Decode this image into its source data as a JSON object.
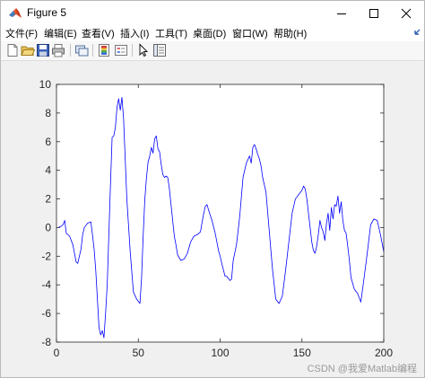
{
  "window": {
    "title": "Figure 5"
  },
  "menu": {
    "items": [
      "文件(F)",
      "编辑(E)",
      "查看(V)",
      "插入(I)",
      "工具(T)",
      "桌面(D)",
      "窗口(W)",
      "帮助(H)"
    ]
  },
  "toolbar": {
    "buttons": [
      "new-figure-icon",
      "open-file-icon",
      "save-icon",
      "print-icon",
      "link-plot-icon",
      "insert-colorbar-icon",
      "insert-legend-icon",
      "edit-plot-arrow-icon",
      "property-inspector-icon"
    ]
  },
  "watermark": "CSDN @我爱Matlab编程",
  "chart_data": {
    "type": "line",
    "title": "",
    "xlabel": "",
    "ylabel": "",
    "xlim": [
      0,
      200
    ],
    "ylim": [
      -8,
      10
    ],
    "xticks": [
      0,
      50,
      100,
      150,
      200
    ],
    "yticks": [
      -8,
      -6,
      -4,
      -2,
      0,
      2,
      4,
      6,
      8,
      10
    ],
    "grid": false,
    "series": [
      {
        "color": "#0000ff",
        "x": [
          1,
          3,
          4,
          5,
          6,
          8,
          10,
          12,
          13,
          14,
          15,
          16,
          17,
          19,
          21,
          22,
          23,
          24,
          25,
          26,
          27,
          28,
          29,
          30,
          31,
          32,
          33,
          34,
          35,
          36,
          37,
          38,
          39,
          40,
          41,
          43,
          45,
          47,
          49,
          51,
          52,
          53,
          54,
          55,
          56,
          57,
          58,
          59,
          60,
          61,
          62,
          63,
          64,
          65,
          66,
          67,
          68,
          69,
          70,
          71,
          72,
          73,
          74,
          76,
          78,
          80,
          82,
          84,
          86,
          88,
          89,
          90,
          91,
          92,
          93,
          95,
          97,
          99,
          100,
          101,
          103,
          104,
          106,
          107,
          108,
          110,
          112,
          114,
          116,
          118,
          119,
          120,
          121,
          122,
          123,
          124,
          125,
          126,
          127,
          128,
          130,
          132,
          134,
          136,
          138,
          140,
          142,
          144,
          146,
          148,
          150,
          151,
          152,
          153,
          154,
          155,
          156,
          157,
          158,
          159,
          160,
          161,
          162,
          163,
          164,
          165,
          166,
          167,
          168,
          169,
          170,
          171,
          172,
          173,
          174,
          175,
          176,
          177,
          178,
          179,
          180,
          182,
          184,
          186,
          188,
          190,
          192,
          194,
          196,
          198,
          200
        ],
        "y": [
          0.0,
          0.1,
          0.2,
          0.5,
          -0.4,
          -0.6,
          -1.2,
          -2.4,
          -2.5,
          -2.0,
          -1.5,
          -0.5,
          0.0,
          0.3,
          0.4,
          -0.5,
          -1.5,
          -3.0,
          -5.0,
          -7.0,
          -7.5,
          -7.2,
          -7.7,
          -6.0,
          -4.0,
          -0.5,
          3.0,
          6.3,
          6.4,
          7.0,
          8.4,
          9.0,
          8.2,
          9.1,
          7.6,
          2.0,
          -1.6,
          -4.5,
          -5.0,
          -5.3,
          -3.5,
          -0.5,
          2.0,
          3.5,
          4.6,
          5.0,
          5.6,
          5.2,
          6.2,
          6.4,
          5.5,
          5.3,
          4.4,
          3.7,
          3.5,
          3.6,
          3.5,
          2.7,
          1.6,
          0.5,
          -0.6,
          -1.2,
          -1.9,
          -2.3,
          -2.2,
          -1.8,
          -1.0,
          -0.6,
          -0.5,
          -0.3,
          0.4,
          1.0,
          1.5,
          1.6,
          1.2,
          0.5,
          -0.4,
          -1.6,
          -2.0,
          -2.5,
          -3.4,
          -3.4,
          -3.7,
          -3.6,
          -2.3,
          -1.2,
          0.8,
          3.5,
          4.5,
          5.0,
          4.5,
          5.6,
          5.8,
          5.5,
          5.1,
          4.8,
          4.3,
          3.5,
          3.0,
          2.5,
          -0.2,
          -2.9,
          -5.0,
          -5.3,
          -4.8,
          -3.0,
          -1.0,
          1.0,
          2.0,
          2.3,
          2.6,
          2.9,
          2.7,
          2.0,
          1.0,
          0.0,
          -1.0,
          -1.6,
          -1.8,
          -1.3,
          -0.5,
          0.5,
          0.0,
          -0.3,
          -0.9,
          0.3,
          1.0,
          -0.2,
          1.4,
          0.6,
          1.6,
          1.5,
          2.2,
          1.0,
          1.8,
          0.5,
          -0.2,
          -0.4,
          -1.3,
          -2.3,
          -3.5,
          -4.3,
          -4.6,
          -5.2,
          -3.5,
          -1.7,
          0.2,
          0.6,
          0.5,
          -0.5,
          -1.7
        ]
      }
    ]
  }
}
